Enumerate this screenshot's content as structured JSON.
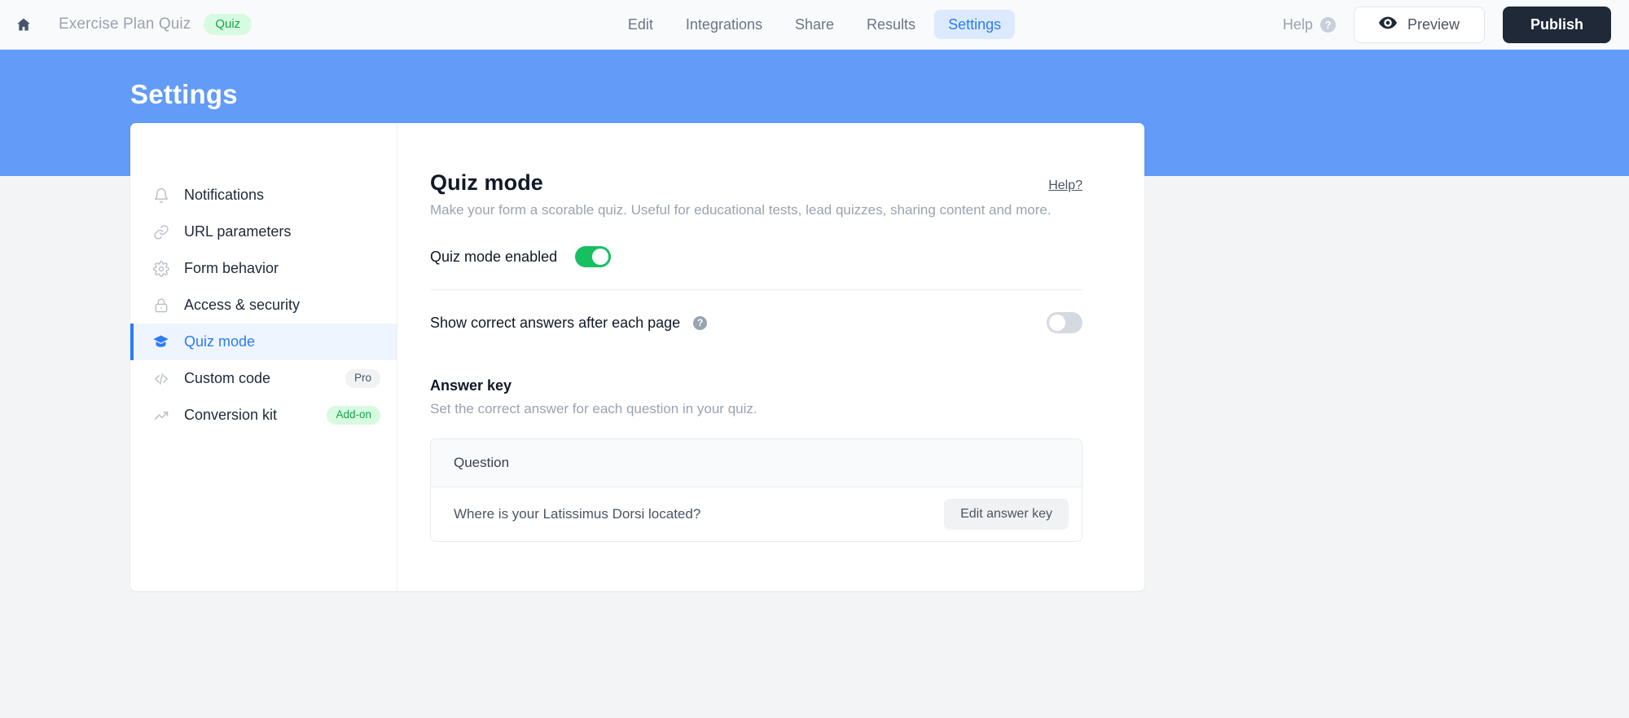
{
  "topbar": {
    "home_icon": "home-icon",
    "form_title": "Exercise Plan Quiz",
    "type_badge": "Quiz",
    "tabs": [
      {
        "label": "Edit",
        "active": false
      },
      {
        "label": "Integrations",
        "active": false
      },
      {
        "label": "Share",
        "active": false
      },
      {
        "label": "Results",
        "active": false
      },
      {
        "label": "Settings",
        "active": true
      }
    ],
    "help_label": "Help",
    "help_icon": "question-mark-icon",
    "preview_label": "Preview",
    "preview_icon": "eye-icon",
    "publish_label": "Publish"
  },
  "hero": {
    "title": "Settings",
    "bg_color": "#629bf8"
  },
  "sidebar": {
    "items": [
      {
        "label": "Notifications",
        "icon": "bell-icon",
        "active": false,
        "badge": null
      },
      {
        "label": "URL parameters",
        "icon": "link-icon",
        "active": false,
        "badge": null
      },
      {
        "label": "Form behavior",
        "icon": "gear-icon",
        "active": false,
        "badge": null
      },
      {
        "label": "Access & security",
        "icon": "lock-icon",
        "active": false,
        "badge": null
      },
      {
        "label": "Quiz mode",
        "icon": "graduation-cap-icon",
        "active": true,
        "badge": null
      },
      {
        "label": "Custom code",
        "icon": "code-icon",
        "active": false,
        "badge": "Pro",
        "badge_kind": "pro"
      },
      {
        "label": "Conversion kit",
        "icon": "trending-up-icon",
        "active": false,
        "badge": "Add-on",
        "badge_kind": "addon"
      }
    ]
  },
  "main": {
    "help_link": "Help?",
    "title": "Quiz mode",
    "subtitle": "Make your form a scorable quiz. Useful for educational tests, lead quizzes, sharing content and more.",
    "toggle_quiz_mode": {
      "label": "Quiz mode enabled",
      "state": "on",
      "on_color": "#16c061"
    },
    "toggle_show_answers": {
      "label": "Show correct answers after each page",
      "hint_icon": "question-mark-icon",
      "state": "off",
      "off_color": "#d5d9e0"
    },
    "answer_key": {
      "title": "Answer key",
      "subtitle": "Set the correct answer for each question in your quiz.",
      "column_header": "Question",
      "rows": [
        {
          "question": "Where is your Latissimus Dorsi located?",
          "action_label": "Edit answer key"
        }
      ]
    }
  }
}
